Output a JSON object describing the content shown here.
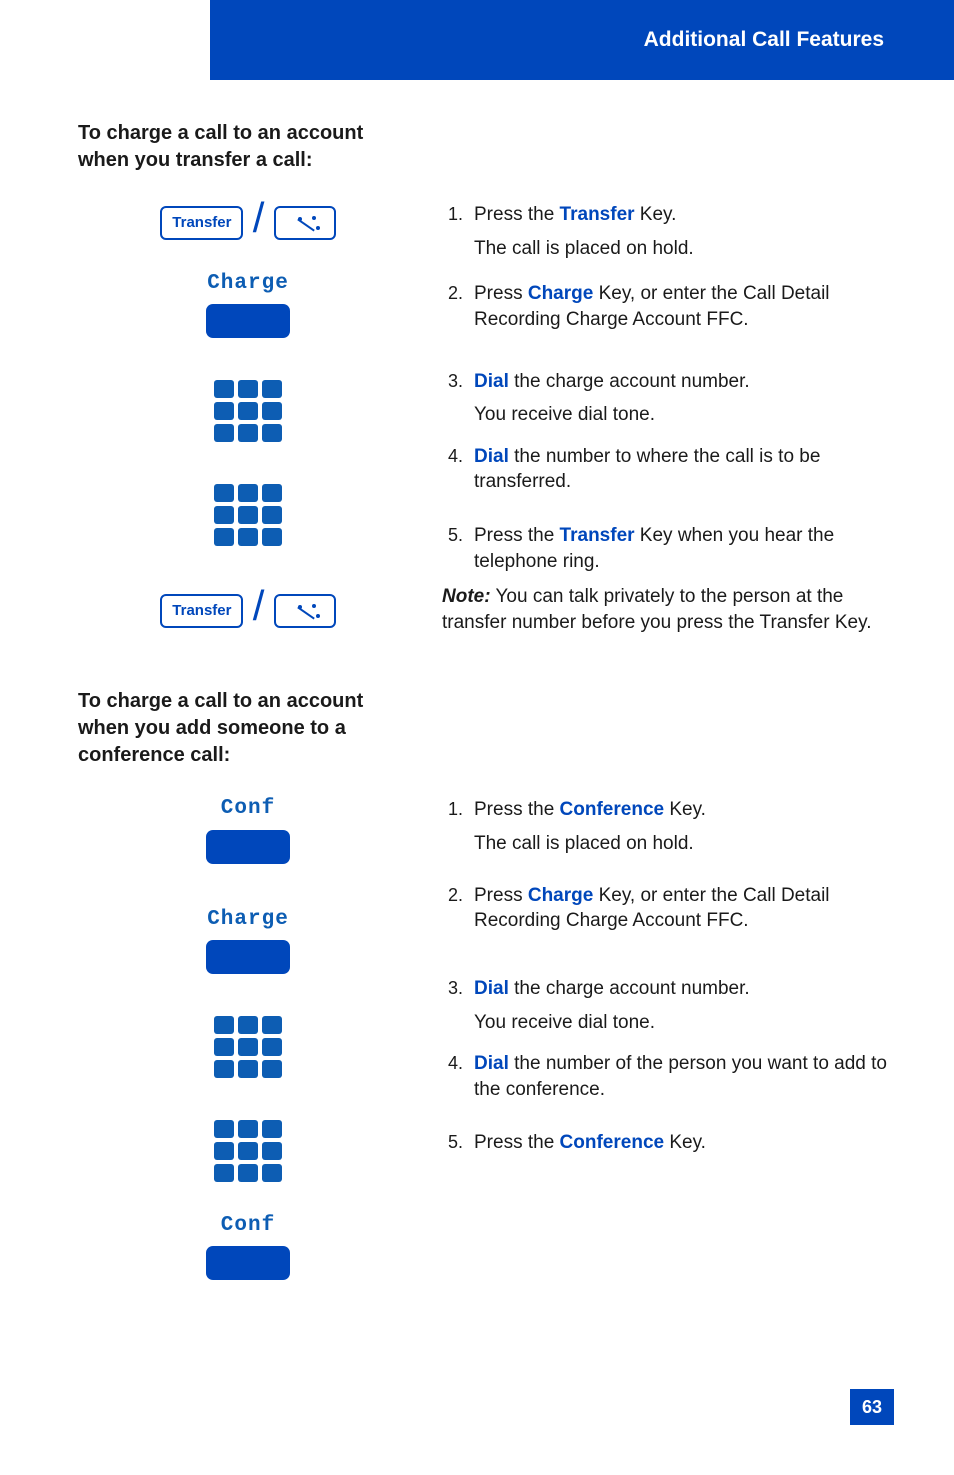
{
  "header": {
    "title": "Additional Call Features"
  },
  "page_number": "63",
  "section1": {
    "title": "To charge a call to an account when you transfer a call:",
    "icons": {
      "transfer": "Transfer",
      "charge": "Charge"
    },
    "steps": {
      "s1a": "Press the ",
      "s1kw": "Transfer",
      "s1b": " Key.",
      "s1sub": "The call is placed on hold.",
      "s2a": "Press ",
      "s2kw": "Charge",
      "s2b": " Key, or enter the Call Detail Recording Charge Account FFC.",
      "s3kw": "Dial",
      "s3a": " the charge account number.",
      "s3sub": "You receive dial tone.",
      "s4kw": "Dial",
      "s4a": " the number to where the call is to be transferred.",
      "s5a": "Press the ",
      "s5kw": "Transfer",
      "s5b": " Key when you hear the telephone ring."
    },
    "note": {
      "label": "Note:",
      "text": " You can talk privately to the person at the transfer number before you press the Transfer Key."
    }
  },
  "section2": {
    "title": "To charge a call to an account when you add someone to a conference call:",
    "icons": {
      "conf": "Conf",
      "charge": "Charge"
    },
    "steps": {
      "s1a": "Press the ",
      "s1kw": "Conference",
      "s1b": " Key.",
      "s1sub": "The call is placed on hold.",
      "s2a": "Press ",
      "s2kw": "Charge",
      "s2b": " Key, or enter the Call Detail Recording Charge Account FFC.",
      "s3kw": "Dial",
      "s3a": " the charge account number.",
      "s3sub": "You receive dial tone.",
      "s4kw": "Dial",
      "s4a": " the number of the person you want to add to the conference.",
      "s5a": "Press the ",
      "s5kw": "Conference",
      "s5b": " Key."
    }
  }
}
